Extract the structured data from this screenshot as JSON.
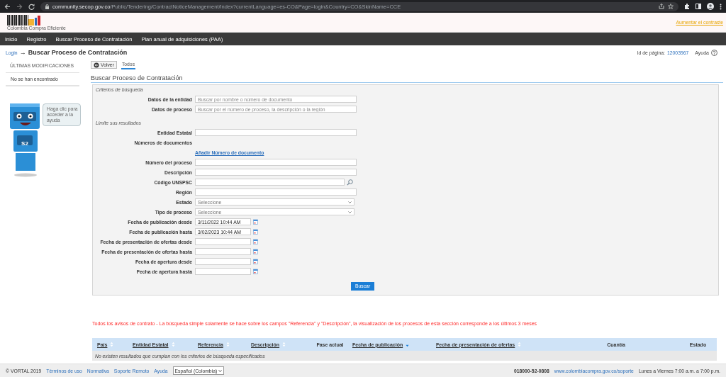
{
  "browser": {
    "url": "**community.secop.gov.co**/Public/Tendering/ContractNoticeManagement/Index?currentLanguage=es-CO&Page=login&Country=CO&SkinName=CCE"
  },
  "header": {
    "logo_caption": "Colombia Compra Eficiente",
    "contrast_link": "Aumentar el contraste"
  },
  "nav": [
    "Inicio",
    "Registro",
    "Buscar Proceso de Contratación",
    "Plan anual de adquisiciones (PAA)"
  ],
  "breadcrumb": {
    "link": "Login",
    "arrow": "→",
    "title": "Buscar Proceso de Contratación"
  },
  "page_id": {
    "label": "Id de página:",
    "value": "12003967"
  },
  "help": "Ayuda",
  "sidebar": {
    "heading": "ÚLTIMAS MODIFICACIONES",
    "empty_text": "No se han encontrado",
    "bubble": "Haga clic para acceder a la ayuda",
    "badge": "S2"
  },
  "toolbar": {
    "back_button": "Volver",
    "tabs": [
      {
        "label": "Todos",
        "selected": true
      }
    ]
  },
  "section_title": "Buscar Proceso de Contratación",
  "form": {
    "groups": [
      {
        "title": "Criterios de búsqueda",
        "fields": [
          {
            "kind": "text",
            "label": "Datos de la entidad",
            "placeholder": "Buscar por nombre o número de documento"
          },
          {
            "kind": "text",
            "label": "Datos de proceso",
            "placeholder": "Buscar por el número de proceso, la descripción o la región"
          }
        ]
      },
      {
        "title": "Limite sus resultados",
        "fields": [
          {
            "kind": "text",
            "label": "Entidad Estatal"
          },
          {
            "kind": "label",
            "label": "Números de documentos"
          },
          {
            "kind": "link",
            "text": "Añadir Número de documento"
          },
          {
            "kind": "text",
            "label": "Número del proceso"
          },
          {
            "kind": "text",
            "label": "Descripción"
          },
          {
            "kind": "search",
            "label": "Código UNSPSC"
          },
          {
            "kind": "text",
            "label": "Región"
          },
          {
            "kind": "select",
            "label": "Estado",
            "value": "Seleccione"
          },
          {
            "kind": "select",
            "label": "Tipo de proceso",
            "value": "Seleccione"
          },
          {
            "kind": "date",
            "label": "Fecha de publicación desde",
            "value": "3/11/2022 10:44 AM"
          },
          {
            "kind": "date",
            "label": "Fecha de publicación hasta",
            "value": "3/02/2023 10:44 AM"
          },
          {
            "kind": "date",
            "label": "Fecha de presentación de ofertas desde"
          },
          {
            "kind": "date",
            "label": "Fecha de presentación de ofertas hasta"
          },
          {
            "kind": "date",
            "label": "Fecha de apertura desde"
          },
          {
            "kind": "date",
            "label": "Fecha de apertura hasta"
          }
        ]
      }
    ],
    "submit": "Buscar"
  },
  "notice": "Todos los avisos de contrato - La búsqueda simple solamente se hace sobre los campos \"Referencia\" y \"Descripción\", la visualización de los procesos de esta sección corresponde a los últimos 3 meses",
  "table": {
    "columns": [
      {
        "label": "País",
        "sortable": true,
        "sorted": false
      },
      {
        "label": "Entidad Estatal",
        "sortable": true,
        "sorted": false
      },
      {
        "label": "Referencia",
        "sortable": true,
        "sorted": false
      },
      {
        "label": "Descripción",
        "sortable": true,
        "sorted": false
      },
      {
        "label": "Fase actual",
        "sortable": false
      },
      {
        "label": "Fecha de publicación",
        "sortable": true,
        "sorted": true
      },
      {
        "label": "Fecha de presentación de ofertas",
        "sortable": true,
        "sorted": false
      },
      {
        "label": "Cuantía",
        "sortable": false
      },
      {
        "label": "Estado",
        "sortable": false
      }
    ],
    "empty_message": "No existen resultados que cumplan con los criterios de búsqueda especificados"
  },
  "footer": {
    "copyright": "© VORTAL 2019",
    "links": [
      "Términos de uso",
      "Normativa",
      "Soporte Remoto",
      "Ayuda"
    ],
    "language": "Español (Colombia)",
    "phone": "018000-52-0808",
    "site_link": "www.colombiacompra.gov.co/soporte",
    "hours": "Lunes a Viernes 7:00 a.m. a 7:00 p.m."
  }
}
